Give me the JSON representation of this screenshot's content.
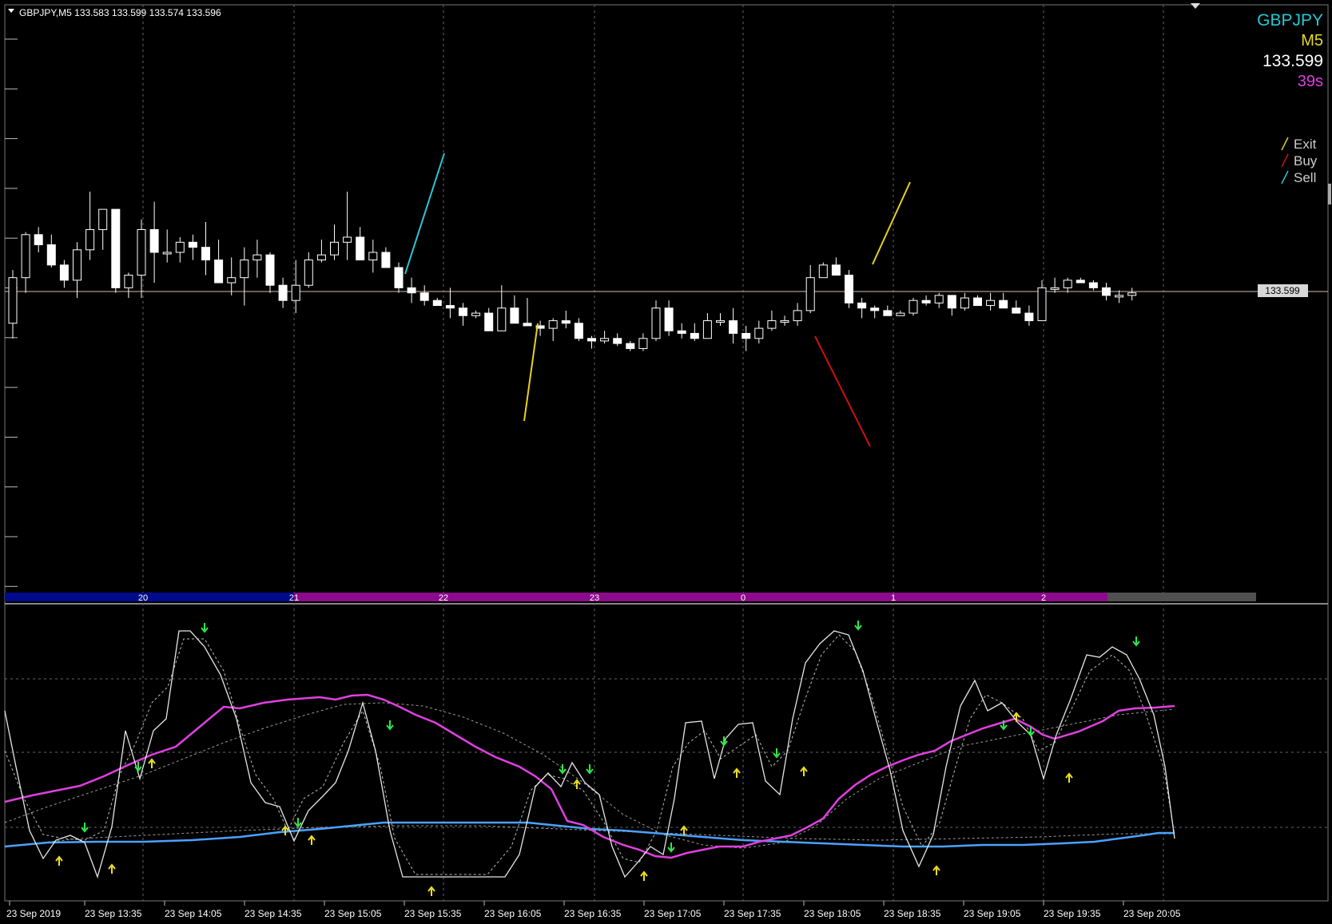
{
  "window": {
    "header_label": "GBPJPY,M5  133.583 133.599 133.574 133.596",
    "menu_arrow_icon": "dropdown-triangle-icon"
  },
  "info_panel": {
    "symbol": "GBPJPY",
    "timeframe": "M5",
    "price": "133.599",
    "countdown": "39s"
  },
  "legend": [
    {
      "label": "Exit",
      "color": "#e6d21e"
    },
    {
      "label": "Buy",
      "color": "#cc1111"
    },
    {
      "label": "Sell",
      "color": "#2cc6d6"
    }
  ],
  "price_line_label": "133.599",
  "hour_bar": {
    "labels": [
      "20",
      "21",
      "22",
      "23",
      "0",
      "1",
      "2"
    ],
    "segment_colors": [
      "#000a8c",
      "#8c0a8c",
      "#8c0a8c",
      "#8c0a8c",
      "#8c0a8c",
      "#8c0a8c",
      "#505050"
    ]
  },
  "time_axis": [
    "23 Sep 2019",
    "23 Sep 13:35",
    "23 Sep 14:05",
    "23 Sep 14:35",
    "23 Sep 15:05",
    "23 Sep 15:35",
    "23 Sep 16:05",
    "23 Sep 16:35",
    "23 Sep 17:05",
    "23 Sep 17:35",
    "23 Sep 18:05",
    "23 Sep 18:35",
    "23 Sep 19:05",
    "23 Sep 19:35",
    "23 Sep 20:05"
  ],
  "colors": {
    "background": "#000000",
    "candle": "#ffffff",
    "grid": "#6b6b6b",
    "price_line": "#cfc2a8",
    "pink_line": "#e040e0",
    "blue_line": "#4aa3ff",
    "signal_down": "#2ee84a",
    "signal_up": "#f0e020",
    "symbol_color": "#25c9d3",
    "timeframe_color": "#e8d820",
    "price_color": "#ffffff",
    "countdown_color": "#e03ce0"
  },
  "chart_data": {
    "type": "candlestick",
    "ohlc": [
      [
        2.5,
        1.9,
        4.6,
        4.3
      ],
      [
        4.3,
        3.7,
        6.1,
        6.0
      ],
      [
        6.0,
        5.3,
        6.3,
        5.6
      ],
      [
        5.6,
        4.7,
        6.0,
        4.8
      ],
      [
        4.8,
        3.9,
        5.0,
        4.2
      ],
      [
        4.2,
        3.5,
        5.7,
        5.4
      ],
      [
        5.4,
        5.0,
        7.7,
        6.2
      ],
      [
        6.2,
        5.4,
        7.0,
        7.0
      ],
      [
        7.0,
        3.7,
        7.0,
        3.9
      ],
      [
        3.9,
        3.5,
        4.5,
        4.4
      ],
      [
        4.4,
        3.5,
        6.6,
        6.2
      ],
      [
        6.2,
        4.1,
        7.3,
        5.3
      ],
      [
        5.3,
        4.9,
        6.2,
        5.3
      ],
      [
        5.3,
        4.9,
        5.9,
        5.7
      ],
      [
        5.7,
        5.0,
        6.0,
        5.5
      ],
      [
        5.5,
        4.4,
        6.5,
        5.0
      ],
      [
        5.0,
        4.1,
        5.8,
        4.1
      ],
      [
        4.1,
        3.6,
        5.1,
        4.3
      ],
      [
        4.3,
        3.2,
        5.5,
        5.0
      ],
      [
        5.0,
        4.3,
        5.8,
        5.2
      ],
      [
        5.2,
        3.7,
        5.3,
        4.0
      ],
      [
        4.0,
        3.1,
        4.3,
        3.4
      ],
      [
        3.4,
        2.9,
        5.0,
        4.0
      ],
      [
        4.0,
        3.9,
        5.3,
        5.0
      ],
      [
        5.0,
        4.9,
        5.8,
        5.2
      ],
      [
        5.2,
        5.0,
        6.4,
        5.7
      ],
      [
        5.7,
        5.0,
        7.7,
        5.9
      ],
      [
        5.9,
        5.0,
        6.3,
        5.0
      ],
      [
        5.0,
        4.5,
        5.8,
        5.3
      ],
      [
        5.3,
        4.7,
        5.5,
        4.7
      ],
      [
        4.7,
        3.7,
        4.9,
        3.9
      ],
      [
        3.9,
        3.3,
        4.3,
        3.7
      ],
      [
        3.7,
        3.2,
        4.0,
        3.4
      ],
      [
        3.4,
        3.2,
        3.5,
        3.2
      ],
      [
        3.2,
        2.7,
        3.9,
        3.1
      ],
      [
        3.1,
        2.4,
        3.3,
        2.8
      ],
      [
        2.8,
        2.7,
        3.0,
        2.9
      ],
      [
        2.9,
        2.2,
        3.1,
        2.2
      ],
      [
        2.2,
        2.2,
        4.0,
        3.1
      ],
      [
        3.1,
        2.5,
        3.6,
        2.5
      ],
      [
        2.5,
        2.4,
        3.5,
        2.4
      ],
      [
        2.4,
        2.0,
        2.6,
        2.3
      ],
      [
        2.3,
        1.8,
        2.7,
        2.6
      ],
      [
        2.6,
        2.3,
        3.0,
        2.5
      ],
      [
        2.5,
        1.8,
        2.7,
        1.9
      ],
      [
        1.9,
        1.5,
        2.0,
        1.8
      ],
      [
        1.8,
        1.7,
        2.2,
        1.9
      ],
      [
        1.9,
        1.6,
        2.1,
        1.7
      ],
      [
        1.7,
        1.4,
        1.8,
        1.5
      ],
      [
        1.5,
        1.4,
        2.1,
        1.9
      ],
      [
        1.9,
        1.8,
        3.4,
        3.1
      ],
      [
        3.1,
        2.0,
        3.4,
        2.2
      ],
      [
        2.2,
        1.9,
        2.5,
        2.1
      ],
      [
        2.1,
        1.8,
        2.5,
        1.9
      ],
      [
        1.9,
        1.9,
        2.9,
        2.6
      ],
      [
        2.6,
        2.4,
        2.9,
        2.6
      ],
      [
        2.6,
        1.7,
        3.1,
        2.1
      ],
      [
        2.1,
        1.4,
        2.4,
        1.9
      ],
      [
        1.9,
        1.7,
        2.6,
        2.3
      ],
      [
        2.3,
        2.2,
        3.0,
        2.6
      ],
      [
        2.6,
        2.4,
        2.8,
        2.6
      ],
      [
        2.6,
        2.4,
        3.3,
        3.0
      ],
      [
        3.0,
        2.9,
        4.8,
        4.3
      ],
      [
        4.3,
        4.3,
        4.9,
        4.8
      ],
      [
        4.8,
        4.5,
        5.1,
        4.4
      ],
      [
        4.4,
        3.1,
        4.6,
        3.3
      ],
      [
        3.3,
        2.7,
        3.5,
        3.1
      ],
      [
        3.1,
        2.7,
        3.2,
        3.0
      ],
      [
        3.0,
        2.8,
        3.2,
        2.8
      ],
      [
        2.8,
        2.8,
        3.0,
        2.9
      ],
      [
        2.9,
        2.8,
        3.5,
        3.4
      ],
      [
        3.4,
        3.2,
        3.6,
        3.3
      ],
      [
        3.3,
        3.1,
        3.7,
        3.6
      ],
      [
        3.6,
        2.8,
        3.6,
        3.1
      ],
      [
        3.1,
        3.0,
        3.7,
        3.5
      ],
      [
        3.5,
        3.4,
        3.6,
        3.2
      ],
      [
        3.2,
        3.0,
        3.7,
        3.4
      ],
      [
        3.4,
        3.1,
        3.7,
        3.1
      ],
      [
        3.1,
        2.9,
        3.4,
        2.9
      ],
      [
        2.9,
        2.4,
        3.2,
        2.6
      ],
      [
        2.6,
        2.6,
        4.2,
        3.9
      ],
      [
        3.9,
        3.7,
        4.3,
        3.9
      ],
      [
        3.9,
        3.7,
        4.3,
        4.2
      ],
      [
        4.2,
        4.1,
        4.3,
        4.1
      ],
      [
        4.1,
        3.8,
        4.2,
        3.9
      ],
      [
        3.9,
        3.4,
        4.1,
        3.6
      ],
      [
        3.6,
        3.3,
        3.8,
        3.6
      ],
      [
        3.6,
        3.4,
        3.9,
        3.7
      ]
    ],
    "current_price_level": 3.75,
    "oscillator": {
      "lines": [
        "white oscillator",
        "dashed signal",
        "pink average",
        "blue average",
        "dashed long average"
      ],
      "grid_levels": [
        "upper",
        "middle",
        "lower"
      ]
    }
  }
}
